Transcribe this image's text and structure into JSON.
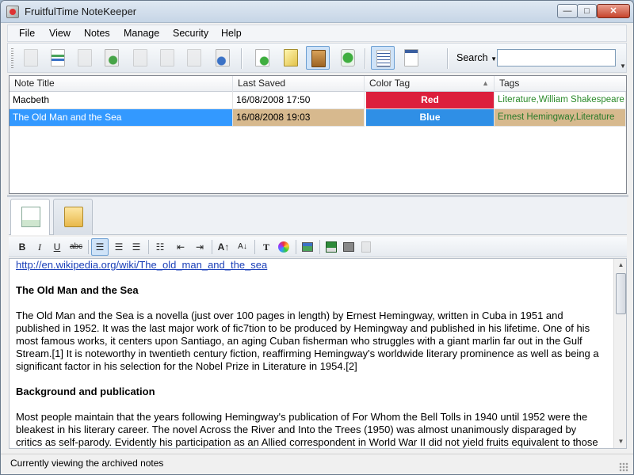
{
  "window": {
    "title": "FruitfulTime NoteKeeper",
    "controls": {
      "minimize": "—",
      "maximize": "□",
      "close": "✕"
    }
  },
  "menu": {
    "items": [
      {
        "label": "File"
      },
      {
        "label": "View"
      },
      {
        "label": "Notes"
      },
      {
        "label": "Manage"
      },
      {
        "label": "Security"
      },
      {
        "label": "Help"
      }
    ]
  },
  "toolbar": {
    "buttons": [
      {
        "icon": "new-note-icon"
      },
      {
        "icon": "edit-note-icon"
      },
      {
        "icon": "copy-note-icon"
      },
      {
        "icon": "recycle-note-icon"
      },
      {
        "icon": "delete-note-icon"
      },
      {
        "icon": "search-note-icon"
      },
      {
        "icon": "print-note-icon"
      },
      {
        "icon": "export-note-icon"
      },
      {
        "icon": "add-note-icon"
      },
      {
        "icon": "lamp-icon"
      },
      {
        "icon": "archive-box-icon"
      },
      {
        "icon": "recycle-bin-icon"
      },
      {
        "icon": "list-view-icon"
      },
      {
        "icon": "detail-view-icon"
      }
    ],
    "search_label": "Search",
    "search_value": ""
  },
  "grid": {
    "columns": [
      "Note Title",
      "Last Saved",
      "Color Tag",
      "Tags"
    ],
    "rows": [
      {
        "title": "Macbeth",
        "saved": "16/08/2008 17:50",
        "color_tag": "Red",
        "color_hex": "#dc1f3c",
        "tags": "Literature,William Shakespeare",
        "selected": false
      },
      {
        "title": "The Old Man and the Sea",
        "saved": "16/08/2008 19:03",
        "color_tag": "Blue",
        "color_hex": "#2f8fe6",
        "tags": "Ernest Hemingway,Literature",
        "selected": true
      }
    ]
  },
  "tabs": [
    {
      "name": "edit-note",
      "icon": "pencil-note-icon"
    },
    {
      "name": "archived-notes",
      "icon": "folder-icon"
    }
  ],
  "format_toolbar": {
    "bold": "B",
    "italic": "I",
    "underline": "U",
    "strike": "abc"
  },
  "document": {
    "link": "http://en.wikipedia.org/wiki/The_old_man_and_the_sea",
    "heading1": "The Old Man and the Sea",
    "para1_lines": [
      "The Old Man and the Sea is a novella (just over 100 pages in length) by Ernest Hemingway, written in Cuba in 1951 and",
      "published in 1952. It was the last major work of fic7tion to be produced by Hemingway and published in his lifetime. One of his",
      "most famous works, it centers upon Santiago, an aging Cuban fisherman who struggles with a giant marlin far out in the Gulf",
      "Stream.[1] It is noteworthy in twentieth century fiction, reaffirming Hemingway's worldwide literary prominence as well as being a",
      "significant factor in his selection for the Nobel Prize in Literature in 1954.[2]"
    ],
    "heading2": "Background and publication",
    "para2_lines": [
      "Most people maintain that the years following Hemingway's publication of For Whom the Bell Tolls in 1940 until 1952 were the",
      "bleakest in his literary career. The novel Across the River and Into the Trees (1950) was almost unanimously disparaged by",
      "critics as self-parody. Evidently his participation as an Allied correspondent in World War II did not yield fruits equivalent to those"
    ]
  },
  "status": {
    "text": "Currently viewing the archived notes"
  }
}
